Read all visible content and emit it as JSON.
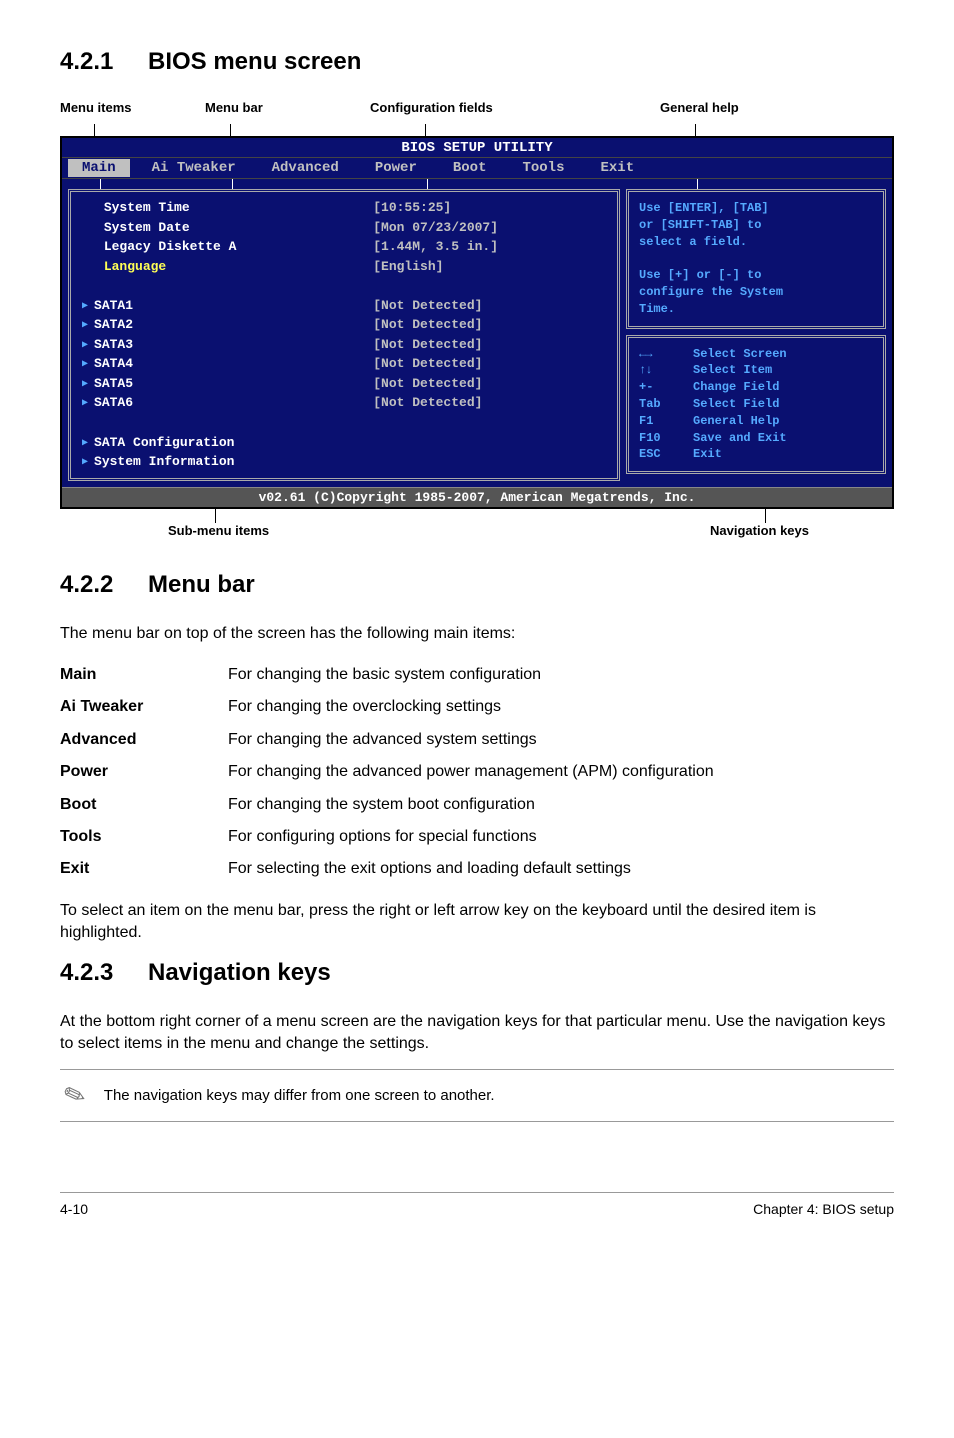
{
  "sections": {
    "s1": {
      "num": "4.2.1",
      "title": "BIOS menu screen"
    },
    "s2": {
      "num": "4.2.2",
      "title": "Menu bar"
    },
    "s3": {
      "num": "4.2.3",
      "title": "Navigation keys"
    }
  },
  "diagram_labels": {
    "menu_items": "Menu items",
    "menu_bar": "Menu bar",
    "config_fields": "Configuration fields",
    "general_help": "General help",
    "sub_menu": "Sub-menu items",
    "nav_keys": "Navigation keys"
  },
  "bios": {
    "header": "BIOS SETUP UTILITY",
    "tabs": [
      "Main",
      "Ai Tweaker",
      "Advanced",
      "Power",
      "Boot",
      "Tools",
      "Exit"
    ],
    "left_rows": [
      {
        "label": "System Time",
        "value": "[10:55:25]",
        "sub": false
      },
      {
        "label": "System Date",
        "value": "[Mon 07/23/2007]",
        "sub": false
      },
      {
        "label": "Legacy Diskette A",
        "value": "[1.44M, 3.5 in.]",
        "sub": false
      },
      {
        "label": "Language",
        "value": "[English]",
        "sub": false,
        "highlight": true
      },
      {
        "spacer": true
      },
      {
        "label": "SATA1",
        "value": "[Not Detected]",
        "sub": true
      },
      {
        "label": "SATA2",
        "value": "[Not Detected]",
        "sub": true
      },
      {
        "label": "SATA3",
        "value": "[Not Detected]",
        "sub": true
      },
      {
        "label": "SATA4",
        "value": "[Not Detected]",
        "sub": true
      },
      {
        "label": "SATA5",
        "value": "[Not Detected]",
        "sub": true
      },
      {
        "label": "SATA6",
        "value": "[Not Detected]",
        "sub": true
      },
      {
        "spacer": true
      },
      {
        "label": "SATA Configuration",
        "value": "",
        "sub": true
      },
      {
        "label": "System Information",
        "value": "",
        "sub": true
      }
    ],
    "help_top": [
      "Use [ENTER], [TAB]",
      "or [SHIFT-TAB] to",
      "select a field.",
      "",
      "Use [+] or [-] to",
      "configure the System",
      "Time."
    ],
    "help_keys": [
      {
        "key": "←→",
        "desc": "Select Screen"
      },
      {
        "key": "↑↓",
        "desc": "Select Item"
      },
      {
        "key": "+-",
        "desc": "Change Field"
      },
      {
        "key": "Tab",
        "desc": "Select Field"
      },
      {
        "key": "F1",
        "desc": "General Help"
      },
      {
        "key": "F10",
        "desc": "Save and Exit"
      },
      {
        "key": "ESC",
        "desc": "Exit"
      }
    ],
    "footer": "v02.61 (C)Copyright 1985-2007, American Megatrends, Inc."
  },
  "menu_bar_intro": "The menu bar on top of the screen has the following main items:",
  "menu_bar_defs": [
    {
      "term": "Main",
      "desc": "For changing the basic system configuration"
    },
    {
      "term": "Ai Tweaker",
      "desc": "For changing the overclocking settings"
    },
    {
      "term": "Advanced",
      "desc": "For changing the advanced system settings"
    },
    {
      "term": "Power",
      "desc": "For changing the advanced power management (APM) configuration"
    },
    {
      "term": "Boot",
      "desc": "For changing the system boot configuration"
    },
    {
      "term": "Tools",
      "desc": "For configuring options for special functions"
    },
    {
      "term": "Exit",
      "desc": "For selecting the exit options and loading default settings"
    }
  ],
  "menu_bar_outro": "To select an item on the menu bar, press the right or left arrow key on the keyboard until the desired item is highlighted.",
  "nav_keys_body": "At the bottom right corner of a menu screen are the navigation keys for that particular menu. Use the navigation keys to select items in the menu and change the settings.",
  "note": "The navigation keys may differ from one screen to another.",
  "footer": {
    "left": "4-10",
    "right": "Chapter 4: BIOS setup"
  }
}
